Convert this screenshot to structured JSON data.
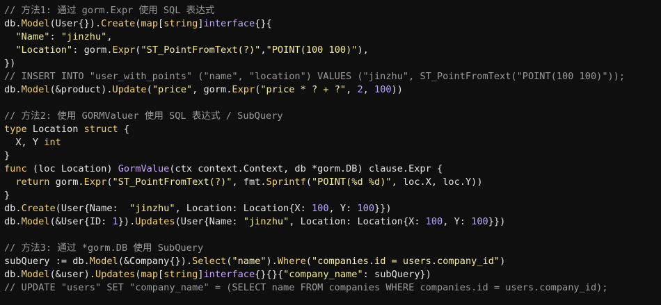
{
  "colors": {
    "background": "#0f0f0f",
    "comment": "#9a9a9a",
    "plain": "#e6e6e6",
    "function": "#f5d26a",
    "string": "#f7ee98",
    "keyword": "#f4d35e",
    "type": "#c9a5ff",
    "number": "#b9a7ff"
  },
  "code": {
    "lines": [
      [
        {
          "k": "comment",
          "t": "// 方法1: 通过 gorm.Expr 使用 SQL 表达式"
        }
      ],
      [
        {
          "k": "plain",
          "t": "db."
        },
        {
          "k": "func",
          "t": "Model"
        },
        {
          "k": "plain",
          "t": "(User{})."
        },
        {
          "k": "func",
          "t": "Create"
        },
        {
          "k": "plain",
          "t": "("
        },
        {
          "k": "func",
          "t": "map"
        },
        {
          "k": "plain",
          "t": "["
        },
        {
          "k": "keyword",
          "t": "string"
        },
        {
          "k": "plain",
          "t": "]"
        },
        {
          "k": "type",
          "t": "interface"
        },
        {
          "k": "plain",
          "t": "{}{"
        }
      ],
      [
        {
          "k": "plain",
          "t": "  "
        },
        {
          "k": "string",
          "t": "\"Name\""
        },
        {
          "k": "plain",
          "t": ": "
        },
        {
          "k": "string",
          "t": "\"jinzhu\""
        },
        {
          "k": "plain",
          "t": ","
        }
      ],
      [
        {
          "k": "plain",
          "t": "  "
        },
        {
          "k": "string",
          "t": "\"Location\""
        },
        {
          "k": "plain",
          "t": ": gorm."
        },
        {
          "k": "func",
          "t": "Expr"
        },
        {
          "k": "plain",
          "t": "("
        },
        {
          "k": "string",
          "t": "\"ST_PointFromText(?)\""
        },
        {
          "k": "plain",
          "t": ","
        },
        {
          "k": "string",
          "t": "\"POINT(100 100)\""
        },
        {
          "k": "plain",
          "t": "),"
        }
      ],
      [
        {
          "k": "plain",
          "t": "})"
        }
      ],
      [
        {
          "k": "comment",
          "t": "// INSERT INTO \"user_with_points\" (\"name\", \"location\") VALUES (\"jinzhu\", ST_PointFromText(\"POINT(100 100)\"));"
        }
      ],
      [
        {
          "k": "plain",
          "t": "db."
        },
        {
          "k": "func",
          "t": "Model"
        },
        {
          "k": "plain",
          "t": "(&product)."
        },
        {
          "k": "func",
          "t": "Update"
        },
        {
          "k": "plain",
          "t": "("
        },
        {
          "k": "string",
          "t": "\"price\""
        },
        {
          "k": "plain",
          "t": ", gorm."
        },
        {
          "k": "func",
          "t": "Expr"
        },
        {
          "k": "plain",
          "t": "("
        },
        {
          "k": "string",
          "t": "\"price * ? + ?\""
        },
        {
          "k": "plain",
          "t": ", "
        },
        {
          "k": "number",
          "t": "2"
        },
        {
          "k": "plain",
          "t": ", "
        },
        {
          "k": "number",
          "t": "100"
        },
        {
          "k": "plain",
          "t": "))"
        }
      ],
      [
        {
          "k": "plain",
          "t": ""
        }
      ],
      [
        {
          "k": "comment",
          "t": "// 方法2: 使用 GORMValuer 使用 SQL 表达式 / SubQuery"
        }
      ],
      [
        {
          "k": "keyword",
          "t": "type"
        },
        {
          "k": "plain",
          "t": " Location "
        },
        {
          "k": "keyword",
          "t": "struct"
        },
        {
          "k": "plain",
          "t": " {"
        }
      ],
      [
        {
          "k": "plain",
          "t": "  X, Y "
        },
        {
          "k": "keyword",
          "t": "int"
        }
      ],
      [
        {
          "k": "plain",
          "t": "}"
        }
      ],
      [
        {
          "k": "keyword",
          "t": "func"
        },
        {
          "k": "plain",
          "t": " (loc Location) "
        },
        {
          "k": "type",
          "t": "GormValue"
        },
        {
          "k": "plain",
          "t": "(ctx context.Context, db *gorm.DB) clause.Expr {"
        }
      ],
      [
        {
          "k": "plain",
          "t": "  "
        },
        {
          "k": "keyword",
          "t": "return"
        },
        {
          "k": "plain",
          "t": " gorm."
        },
        {
          "k": "func",
          "t": "Expr"
        },
        {
          "k": "plain",
          "t": "("
        },
        {
          "k": "string",
          "t": "\"ST_PointFromText(?)\""
        },
        {
          "k": "plain",
          "t": ", fmt."
        },
        {
          "k": "func",
          "t": "Sprintf"
        },
        {
          "k": "plain",
          "t": "("
        },
        {
          "k": "string",
          "t": "\"POINT(%d %d)\""
        },
        {
          "k": "plain",
          "t": ", loc.X, loc.Y))"
        }
      ],
      [
        {
          "k": "plain",
          "t": "}"
        }
      ],
      [
        {
          "k": "plain",
          "t": "db."
        },
        {
          "k": "func",
          "t": "Create"
        },
        {
          "k": "plain",
          "t": "(User{Name:  "
        },
        {
          "k": "string",
          "t": "\"jinzhu\""
        },
        {
          "k": "plain",
          "t": ", Location: Location{X: "
        },
        {
          "k": "number",
          "t": "100"
        },
        {
          "k": "plain",
          "t": ", Y: "
        },
        {
          "k": "number",
          "t": "100"
        },
        {
          "k": "plain",
          "t": "}})"
        }
      ],
      [
        {
          "k": "plain",
          "t": "db."
        },
        {
          "k": "func",
          "t": "Model"
        },
        {
          "k": "plain",
          "t": "(&User{ID: "
        },
        {
          "k": "number",
          "t": "1"
        },
        {
          "k": "plain",
          "t": "})."
        },
        {
          "k": "func",
          "t": "Updates"
        },
        {
          "k": "plain",
          "t": "(User{Name: "
        },
        {
          "k": "string",
          "t": "\"jinzhu\""
        },
        {
          "k": "plain",
          "t": ", Location: Location{X: "
        },
        {
          "k": "number",
          "t": "100"
        },
        {
          "k": "plain",
          "t": ", Y: "
        },
        {
          "k": "number",
          "t": "100"
        },
        {
          "k": "plain",
          "t": "}})"
        }
      ],
      [
        {
          "k": "plain",
          "t": ""
        }
      ],
      [
        {
          "k": "comment",
          "t": "// 方法3: 通过 *gorm.DB 使用 SubQuery"
        }
      ],
      [
        {
          "k": "plain",
          "t": "subQuery := db."
        },
        {
          "k": "func",
          "t": "Model"
        },
        {
          "k": "plain",
          "t": "(&Company{})."
        },
        {
          "k": "func",
          "t": "Select"
        },
        {
          "k": "plain",
          "t": "("
        },
        {
          "k": "string",
          "t": "\"name\""
        },
        {
          "k": "plain",
          "t": ")."
        },
        {
          "k": "func",
          "t": "Where"
        },
        {
          "k": "plain",
          "t": "("
        },
        {
          "k": "string",
          "t": "\"companies.id = users.company_id\""
        },
        {
          "k": "plain",
          "t": ")"
        }
      ],
      [
        {
          "k": "plain",
          "t": "db."
        },
        {
          "k": "func",
          "t": "Model"
        },
        {
          "k": "plain",
          "t": "(&user)."
        },
        {
          "k": "func",
          "t": "Updates"
        },
        {
          "k": "plain",
          "t": "("
        },
        {
          "k": "func",
          "t": "map"
        },
        {
          "k": "plain",
          "t": "["
        },
        {
          "k": "keyword",
          "t": "string"
        },
        {
          "k": "plain",
          "t": "]"
        },
        {
          "k": "type",
          "t": "interface"
        },
        {
          "k": "plain",
          "t": "{}{}{"
        },
        {
          "k": "string",
          "t": "\"company_name\""
        },
        {
          "k": "plain",
          "t": ": subQuery})"
        }
      ],
      [
        {
          "k": "comment",
          "t": "// UPDATE \"users\" SET \"company_name\" = (SELECT name FROM companies WHERE companies.id = users.company_id);"
        }
      ]
    ]
  }
}
